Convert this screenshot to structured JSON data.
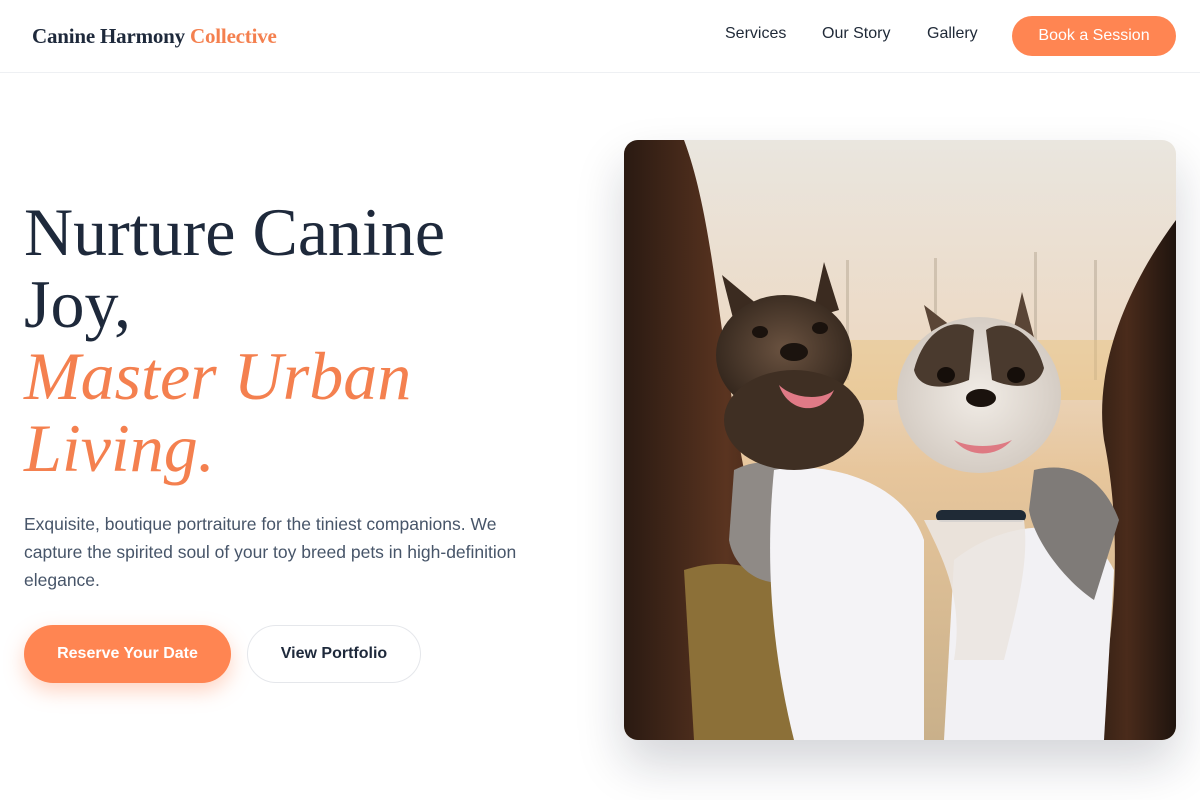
{
  "brand": {
    "name_primary": "Canine Harmony",
    "name_accent": "Collective",
    "accent_color": "#f4804f",
    "button_color": "#ff8552"
  },
  "nav": {
    "items": [
      {
        "label": "Services"
      },
      {
        "label": "Our Story"
      },
      {
        "label": "Gallery"
      }
    ],
    "cta_label": "Book a Session"
  },
  "hero": {
    "headline_line1": "Nurture Canine",
    "headline_line2": "Joy,",
    "headline_italic_line1": "Master Urban",
    "headline_italic_line2": "Living.",
    "description": "Exquisite, boutique portraiture for the tiniest companions. We capture the spirited soul of your toy breed pets in high-definition elegance.",
    "primary_button": "Reserve Your Date",
    "secondary_button": "View Portfolio"
  },
  "image": {
    "subject": "two-french-bulldogs-held-by-women"
  }
}
